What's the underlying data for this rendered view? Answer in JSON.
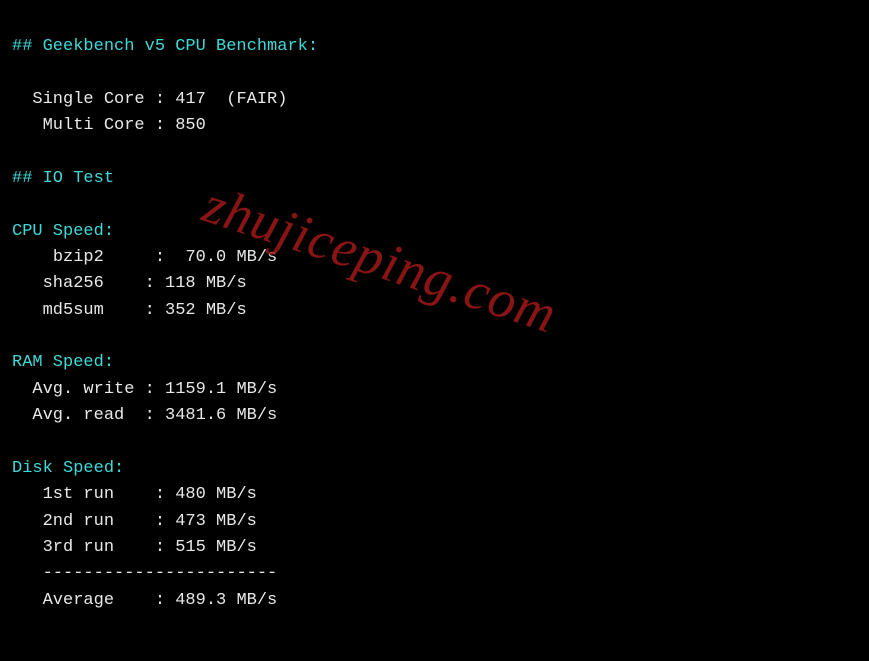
{
  "watermark": "zhujiceping.com",
  "headers": {
    "geekbench": "## Geekbench v5 CPU Benchmark:",
    "iotest": "## IO Test"
  },
  "geekbench": {
    "single_label": "Single Core : ",
    "single_value": "417  (FAIR)",
    "multi_label": "Multi Core : ",
    "multi_value": "850"
  },
  "cpu_speed": {
    "title": "CPU Speed:",
    "bzip2_label": "bzip2     :  ",
    "bzip2_value": "70.0 MB/s",
    "sha256_label": "sha256    : ",
    "sha256_value": "118 MB/s",
    "md5sum_label": "md5sum    : ",
    "md5sum_value": "352 MB/s"
  },
  "ram_speed": {
    "title": "RAM Speed:",
    "write_label": "Avg. write : ",
    "write_value": "1159.1 MB/s",
    "read_label": "Avg. read  : ",
    "read_value": "3481.6 MB/s"
  },
  "disk_speed": {
    "title": "Disk Speed:",
    "run1_label": "1st run    : ",
    "run1_value": "480 MB/s",
    "run2_label": "2nd run    : ",
    "run2_value": "473 MB/s",
    "run3_label": "3rd run    : ",
    "run3_value": "515 MB/s",
    "divider": "-----------------------",
    "avg_label": "Average    : ",
    "avg_value": "489.3 MB/s"
  }
}
